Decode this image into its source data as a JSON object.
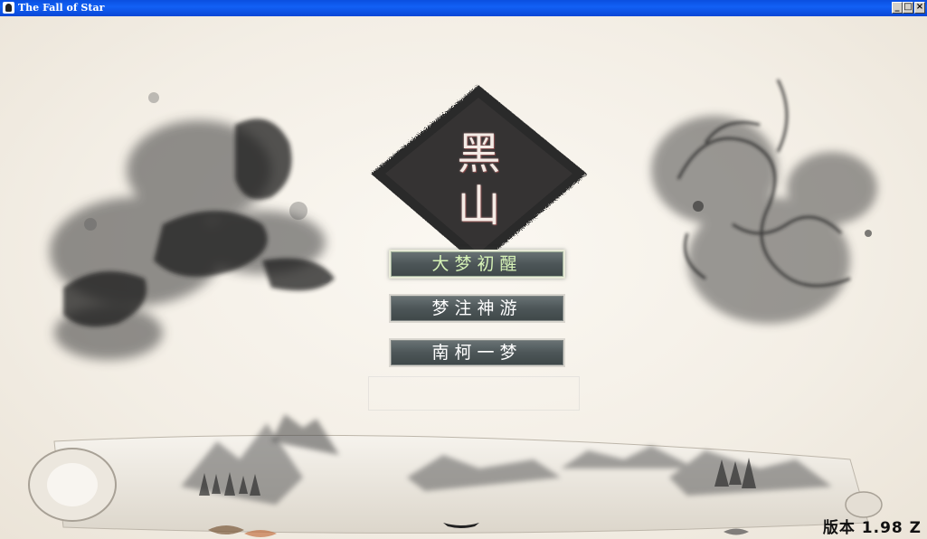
{
  "window": {
    "title": "The Fall of Star",
    "minimize_glyph": "_",
    "maximize_glyph": "□",
    "close_glyph": "×"
  },
  "emblem": {
    "line1": "黑",
    "line2": "山"
  },
  "menu": {
    "items": [
      {
        "label": "大梦初醒",
        "selected": true
      },
      {
        "label": "梦注神游",
        "selected": false
      },
      {
        "label": "南柯一梦",
        "selected": false
      }
    ]
  },
  "footer": {
    "version": "版本 1.98 Z"
  },
  "colors": {
    "background": "#f4efe6",
    "button_fill": "#4d5658",
    "button_selected_text": "#d6f3b7",
    "titlebar": "#0a4fe0"
  }
}
